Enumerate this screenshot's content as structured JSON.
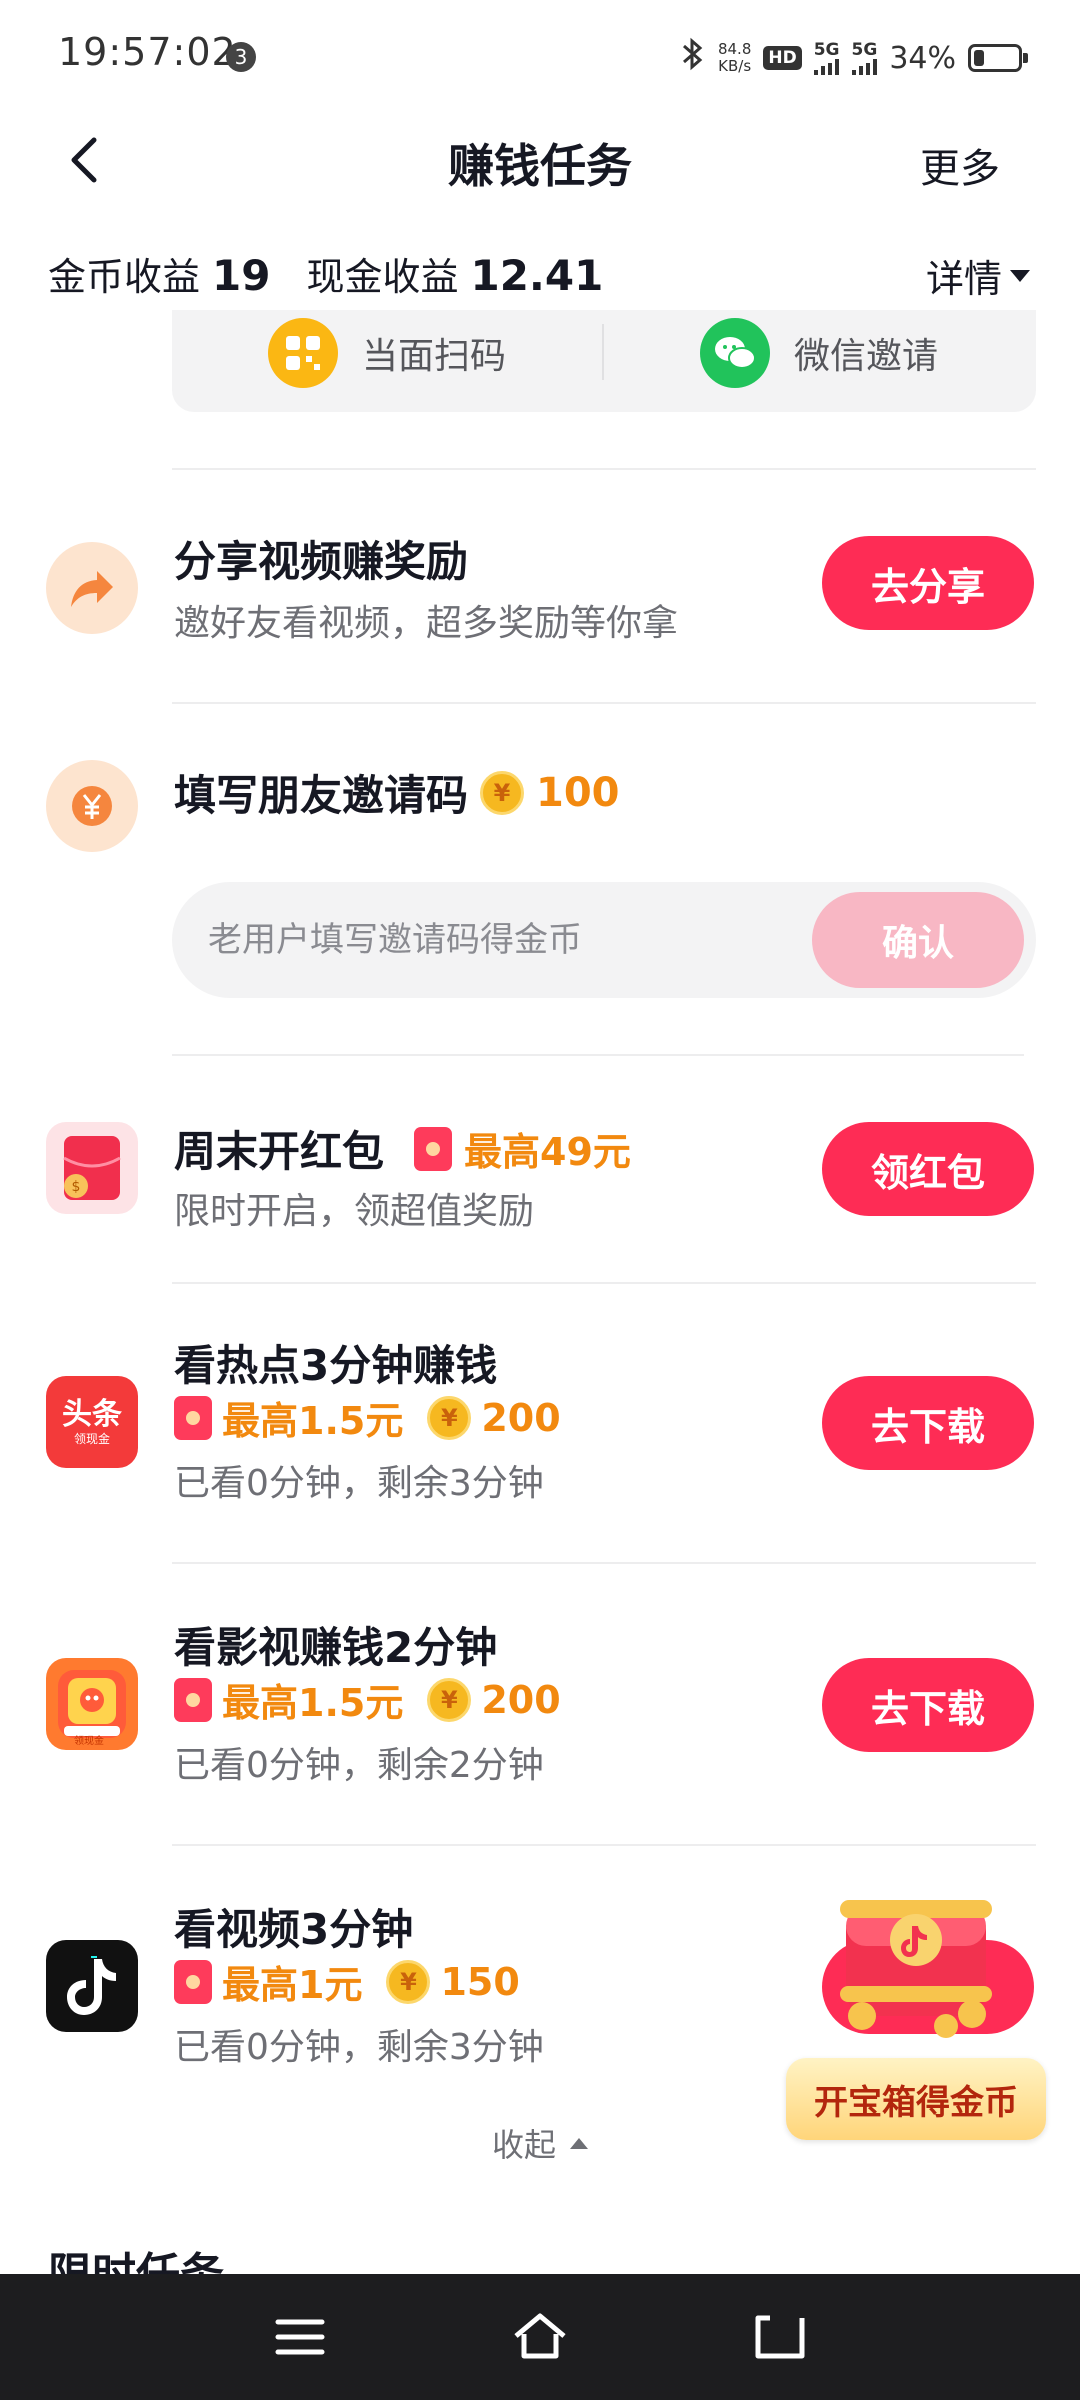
{
  "status_bar": {
    "time": "19:57:02",
    "notification_count": "3",
    "net_speed_value": "84.8",
    "net_speed_unit": "KB/s",
    "hd_label": "HD",
    "signal1_label": "5G",
    "signal2_label": "5G",
    "battery_text": "34%",
    "battery_level": 0.34
  },
  "header": {
    "title": "赚钱任务",
    "more_label": "更多"
  },
  "earnings": {
    "coin_label": "金币收益",
    "coin_value": "19",
    "cash_label": "现金收益",
    "cash_value": "12.41",
    "detail_label": "详情"
  },
  "invite_methods": [
    {
      "label": "当面扫码",
      "icon": "qr-code-icon"
    },
    {
      "label": "微信邀请",
      "icon": "wechat-icon"
    }
  ],
  "tasks": {
    "share": {
      "title": "分享视频赚奖励",
      "subtitle": "邀好友看视频，超多奖励等你拿",
      "button": "去分享"
    },
    "invite_code": {
      "title": "填写朋友邀请码",
      "coin_amount": "100",
      "placeholder": "老用户填写邀请码得金币",
      "confirm_label": "确认"
    },
    "weekend": {
      "title": "周末开红包",
      "reward": "最高49元",
      "subtitle": "限时开启，领超值奖励",
      "button": "领红包"
    },
    "hot": {
      "title": "看热点3分钟赚钱",
      "cash_reward": "最高1.5元",
      "coin_amount": "200",
      "progress": "已看0分钟，剩余3分钟",
      "button": "去下载",
      "app_icon_text": "头条",
      "app_icon_sub": "领现金"
    },
    "movie": {
      "title": "看影视赚钱2分钟",
      "cash_reward": "最高1.5元",
      "coin_amount": "200",
      "progress": "已看0分钟，剩余2分钟",
      "button": "去下载",
      "app_icon_sub": "领现金"
    },
    "video": {
      "title": "看视频3分钟",
      "cash_reward": "最高1元",
      "coin_amount": "150",
      "progress": "已看0分钟，剩余3分钟"
    }
  },
  "collapse_label": "收起",
  "next_section_title": "限时任务",
  "treasure": {
    "label": "开宝箱得金币"
  },
  "colors": {
    "accent_red": "#fe2c55",
    "reward_orange": "#f2890f",
    "confirm_disabled": "#f8b7c4"
  }
}
